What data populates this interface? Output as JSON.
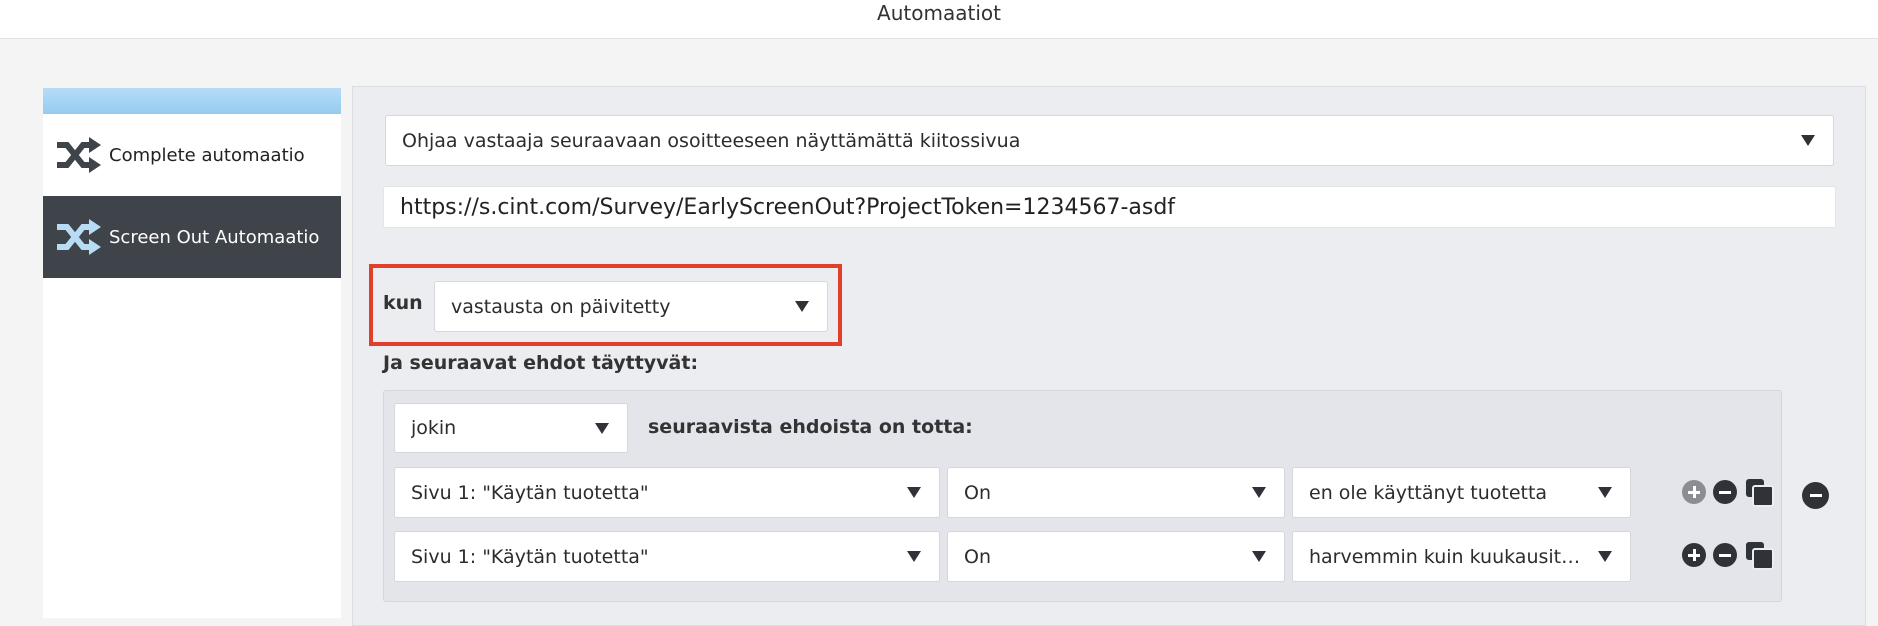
{
  "window": {
    "title": "Automaatiot"
  },
  "sidebar": {
    "items": [
      {
        "label": "Complete automaatio",
        "icon": "shuffle-icon",
        "active": false
      },
      {
        "label": "Screen Out Automaatio",
        "icon": "shuffle-icon",
        "active": true
      }
    ]
  },
  "action": {
    "selected": "Ohjaa vastaaja seuraavaan osoitteeseen näyttämättä kiitossivua"
  },
  "url": {
    "value": "https://s.cint.com/Survey/EarlyScreenOut?ProjectToken=1234567-asdf"
  },
  "trigger": {
    "label": "kun",
    "selected": "vastausta on päivitetty"
  },
  "conditions": {
    "heading": "Ja seuraavat ehdot täyttyvät:",
    "match_selected": "jokin",
    "match_suffix": "seuraavista ehdoista on totta:",
    "rows": [
      {
        "question": "Sivu 1: \"Käytän tuotetta\"",
        "operator": "On",
        "value": "en ole käyttänyt tuotetta"
      },
      {
        "question": "Sivu 1: \"Käytän tuotetta\"",
        "operator": "On",
        "value": "harvemmin kuin kuukausit…"
      }
    ]
  },
  "colors": {
    "sidebar_active_bg": "#3f434a",
    "sidebar_accent": "#95cbf1",
    "highlight_border": "#e0402b"
  }
}
